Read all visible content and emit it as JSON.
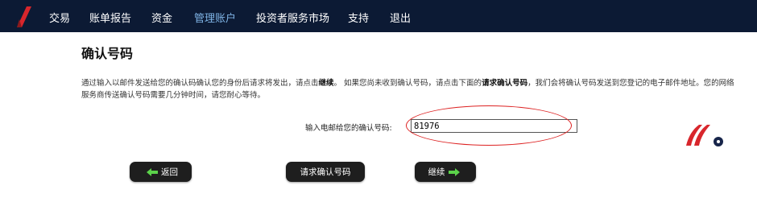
{
  "nav": {
    "items": [
      {
        "label": "交易",
        "active": false
      },
      {
        "label": "账单报告",
        "active": false
      },
      {
        "label": "资金",
        "active": false
      },
      {
        "label": "管理账户",
        "active": true
      },
      {
        "label": "投资者服务市场",
        "active": false
      },
      {
        "label": "支持",
        "active": false
      },
      {
        "label": "退出",
        "active": false
      }
    ]
  },
  "page": {
    "title": "确认号码",
    "instructions": {
      "part1": "通过输入以邮件发送给您的确认码确认您的身份后请求将发出，请点击",
      "bold1": "继续",
      "part2": "。 如果您尚未收到确认号码，请点击下面的",
      "bold2": "请求确认号码",
      "part3": "，我们会将确认号码发送到您登记的电子邮件地址。您的网络服务商传送确认号码需要几分钟时间，请您耐心等待。"
    }
  },
  "form": {
    "label": "输入电邮给您的确认号码:",
    "value": "81976"
  },
  "buttons": {
    "back": "返回",
    "request": "请求确认号码",
    "next": "继续"
  },
  "colors": {
    "navbar": "#0c1a34",
    "nav_active": "#7fb4e6",
    "logo": "#d8262c",
    "arrow": "#5bd24a",
    "annotation": "#d22"
  }
}
